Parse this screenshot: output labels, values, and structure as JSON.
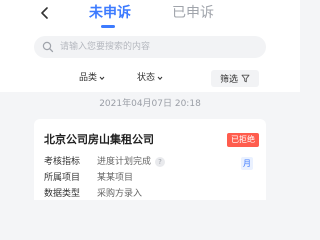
{
  "header": {
    "tabs": [
      {
        "label": "未申诉",
        "active": true
      },
      {
        "label": "已申诉",
        "active": false
      }
    ]
  },
  "search": {
    "placeholder": "请输入您要搜索的内容"
  },
  "filters": {
    "category_label": "品类",
    "status_label": "状态",
    "screen_label": "筛选"
  },
  "list": {
    "date": "2021年04月07日 20:18",
    "card": {
      "title": "北京公司房山集租公司",
      "badge": "已拒绝",
      "month_chip": "月",
      "rows": [
        {
          "label": "考核指标",
          "value": "进度计划完成"
        },
        {
          "label": "所属项目",
          "value": "某某项目"
        },
        {
          "label": "数据类型",
          "value": "采购方录入"
        }
      ]
    }
  },
  "colors": {
    "accent": "#3d7bff",
    "badge": "#ff5c4d",
    "background": "#f4f5f7"
  },
  "icons": [
    "back-arrow-icon",
    "search-icon",
    "caret-down-icon",
    "filter-funnel-icon",
    "help-icon"
  ]
}
